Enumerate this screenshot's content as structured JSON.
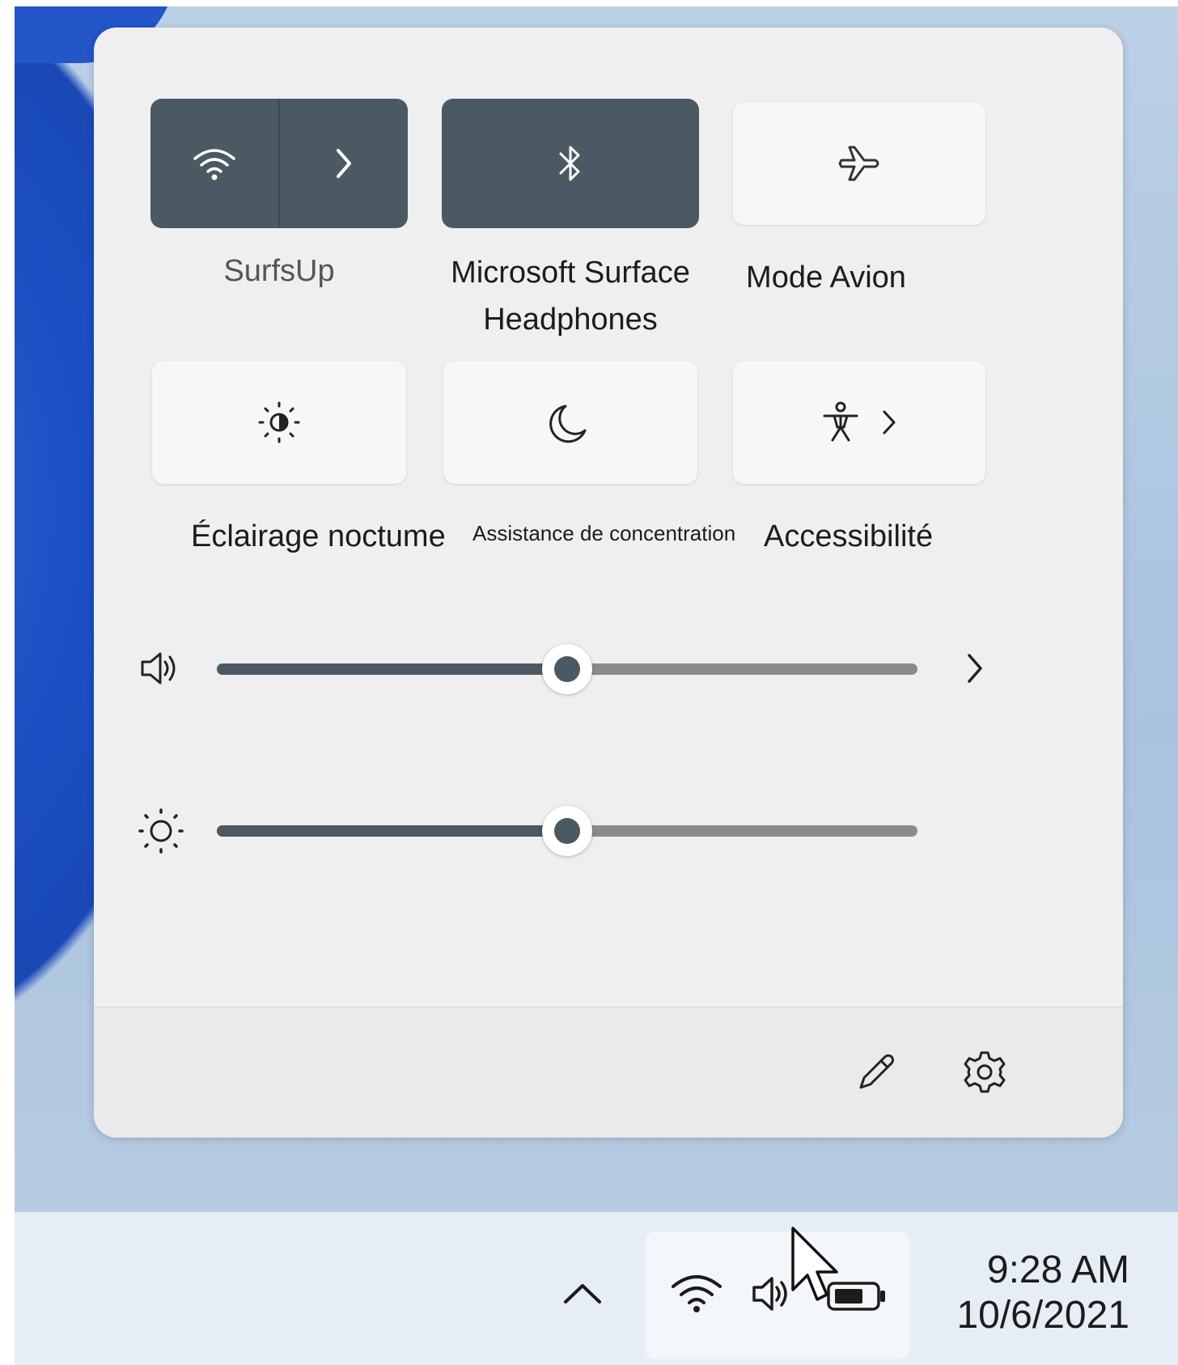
{
  "tiles": {
    "wifi": {
      "label": "SurfsUp",
      "icon": "wifi-icon",
      "state": "on"
    },
    "bluetooth": {
      "label_line1": "Microsoft Surface",
      "label_line2": "Headphones",
      "icon": "bluetooth-icon",
      "state": "on"
    },
    "airplane": {
      "label": "Mode Avion",
      "icon": "airplane-icon",
      "state": "off"
    },
    "night_light": {
      "label": "Éclairage noctume",
      "icon": "night-light-icon",
      "state": "off"
    },
    "focus": {
      "label": "Assistance de concentration",
      "icon": "moon-icon",
      "state": "off"
    },
    "accessibility": {
      "label": "Accessibilité",
      "icon": "accessibility-icon",
      "state": "off"
    }
  },
  "sliders": {
    "volume": {
      "icon": "speaker-icon",
      "value_percent": 50
    },
    "brightness": {
      "icon": "sun-icon",
      "value_percent": 50
    }
  },
  "footer": {
    "edit_icon": "pencil-icon",
    "settings_icon": "gear-icon"
  },
  "taskbar": {
    "overflow_icon": "chevron-up-icon",
    "tray_icons": [
      "wifi-icon",
      "speaker-icon",
      "battery-icon"
    ],
    "time": "9:28 AM",
    "date": "10/6/2021"
  },
  "colors": {
    "accent_tile": "#4b5963",
    "panel": "#efefef",
    "slider_track": "#8a8a8a"
  }
}
